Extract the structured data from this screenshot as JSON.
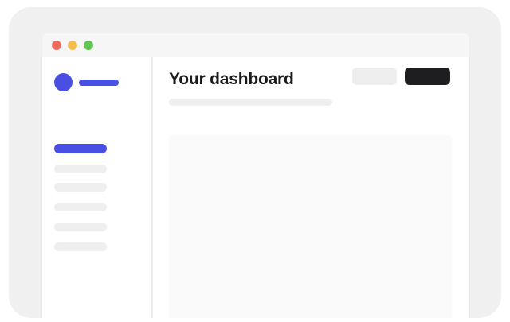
{
  "window": {
    "controls": [
      {
        "name": "close",
        "color": "#ec6a5e"
      },
      {
        "name": "minimize",
        "color": "#f4bf4f"
      },
      {
        "name": "maximize",
        "color": "#61c554"
      }
    ]
  },
  "brand": {
    "accent": "#4a4fe4"
  },
  "sidebar": {
    "active_color": "#4a4fe4",
    "inactive_color": "#efeff0",
    "item_count": 6,
    "active_index": 0
  },
  "main": {
    "title": "Your dashboard",
    "secondary_button_color": "#eeeeef",
    "primary_button_color": "#1e1e20"
  }
}
